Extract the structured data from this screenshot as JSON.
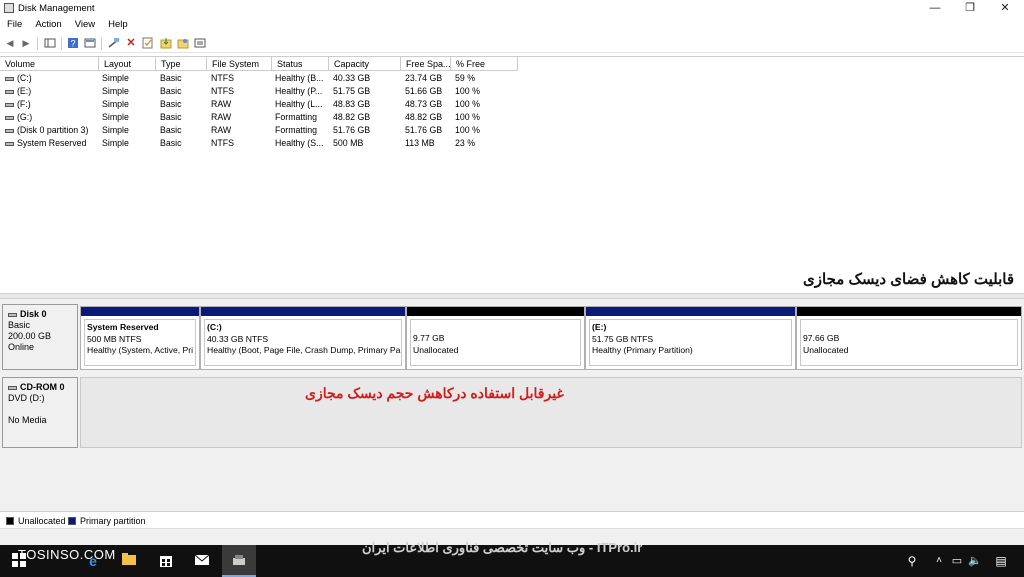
{
  "window": {
    "title": "Disk Management",
    "minimize": "—",
    "restore": "❐",
    "close": "✕"
  },
  "menu": [
    "File",
    "Action",
    "View",
    "Help"
  ],
  "toolbar": {
    "back": "◀",
    "forward": "▶"
  },
  "columns": [
    "Volume",
    "Layout",
    "Type",
    "File System",
    "Status",
    "Capacity",
    "Free Spa...",
    "% Free"
  ],
  "volumes": [
    {
      "volume": "(C:)",
      "layout": "Simple",
      "type": "Basic",
      "fs": "NTFS",
      "status": "Healthy (B...",
      "capacity": "40.33 GB",
      "free": "23.74 GB",
      "pct": "59 %"
    },
    {
      "volume": "(E:)",
      "layout": "Simple",
      "type": "Basic",
      "fs": "NTFS",
      "status": "Healthy (P...",
      "capacity": "51.75 GB",
      "free": "51.66 GB",
      "pct": "100 %"
    },
    {
      "volume": "(F:)",
      "layout": "Simple",
      "type": "Basic",
      "fs": "RAW",
      "status": "Healthy (L...",
      "capacity": "48.83 GB",
      "free": "48.73 GB",
      "pct": "100 %"
    },
    {
      "volume": "(G:)",
      "layout": "Simple",
      "type": "Basic",
      "fs": "RAW",
      "status": "Formatting",
      "capacity": "48.82 GB",
      "free": "48.82 GB",
      "pct": "100 %"
    },
    {
      "volume": "(Disk 0 partition 3)",
      "layout": "Simple",
      "type": "Basic",
      "fs": "RAW",
      "status": "Formatting",
      "capacity": "51.76 GB",
      "free": "51.76 GB",
      "pct": "100 %"
    },
    {
      "volume": "System Reserved",
      "layout": "Simple",
      "type": "Basic",
      "fs": "NTFS",
      "status": "Healthy (S...",
      "capacity": "500 MB",
      "free": "113 MB",
      "pct": "23 %"
    }
  ],
  "captions": {
    "top": "قابلیت کاهش فضای دیسک مجازی",
    "bottom": "غیرقابل استفاده درکاهش حجم دیسک مجازی"
  },
  "disk0": {
    "name": "Disk 0",
    "type": "Basic",
    "size": "200.00 GB",
    "state": "Online",
    "partitions": [
      {
        "name": "System Reserved",
        "size": "500 MB NTFS",
        "status": "Healthy (System, Active, Pri",
        "kind": "primary"
      },
      {
        "name": "(C:)",
        "size": "40.33 GB NTFS",
        "status": "Healthy (Boot, Page File, Crash Dump, Primary Pa",
        "kind": "primary"
      },
      {
        "name": "",
        "size": "9.77 GB",
        "status": "Unallocated",
        "kind": "unallocated"
      },
      {
        "name": "(E:)",
        "size": "51.75 GB NTFS",
        "status": "Healthy (Primary Partition)",
        "kind": "primary"
      },
      {
        "name": "",
        "size": "97.66 GB",
        "status": "Unallocated",
        "kind": "unallocated"
      }
    ]
  },
  "cdrom": {
    "name": "CD-ROM 0",
    "drive": "DVD (D:)",
    "media": "No Media"
  },
  "legend": {
    "unallocated": "Unallocated",
    "primary": "Primary partition"
  },
  "colors": {
    "primary": "#0a1a78",
    "unallocated": "#000000",
    "caption": "#d61a1a"
  },
  "taskbar": {
    "watermark": "TOSINSO.COM",
    "banner": "ITPro.ir - وب سایت تخصصی فناوری اطلاعات ایران"
  }
}
